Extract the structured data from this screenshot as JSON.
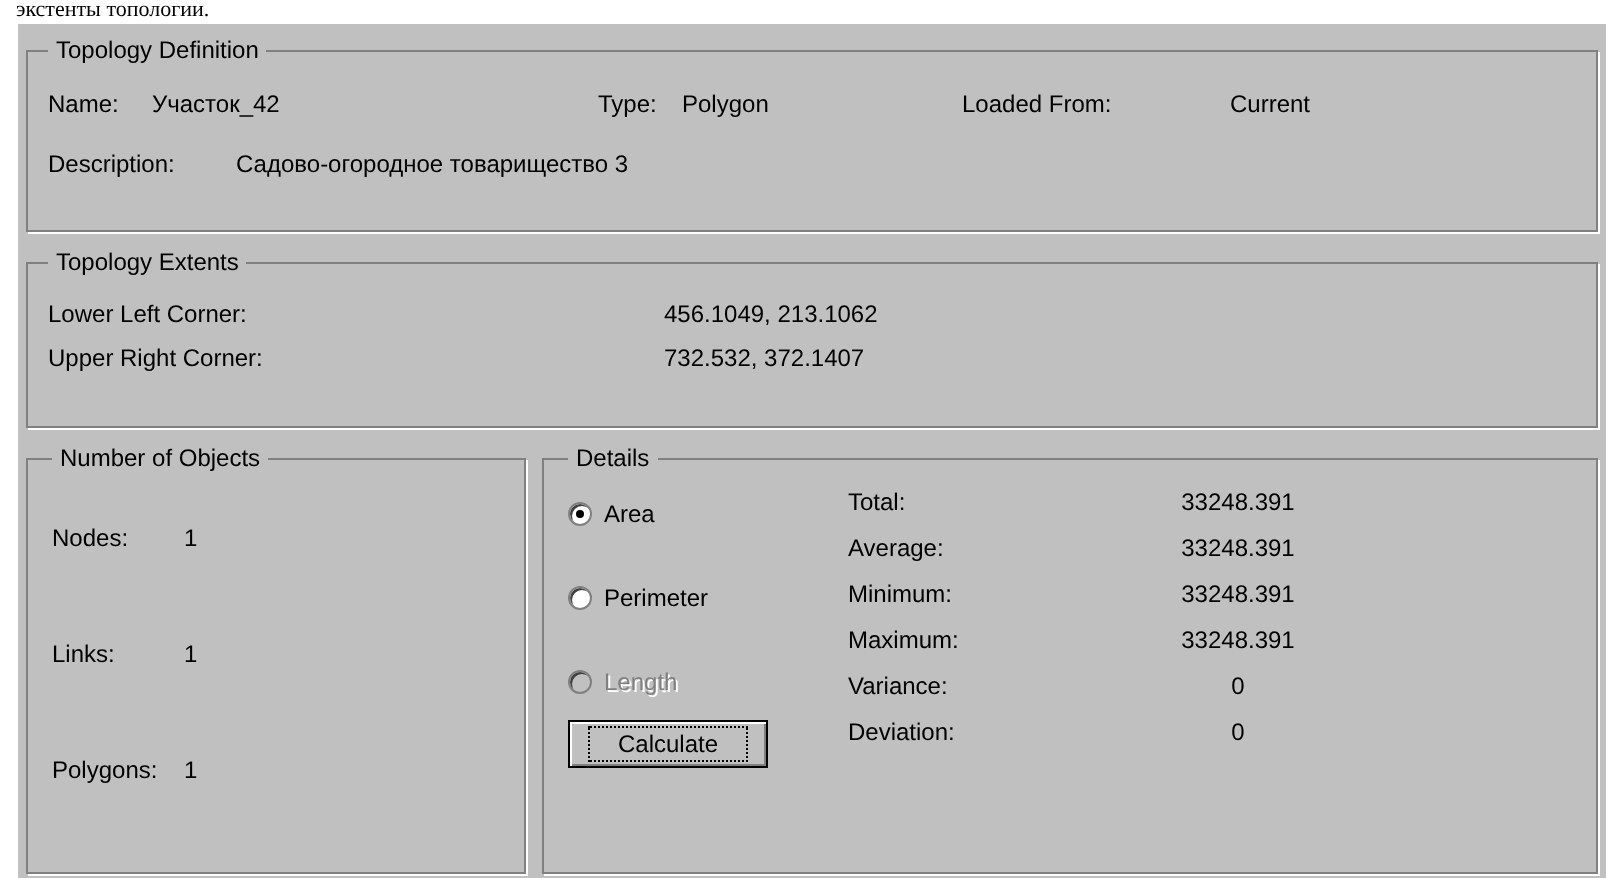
{
  "caption": "экстенты топологии.",
  "topology_definition": {
    "title": "Topology Definition",
    "fields": [
      {
        "label": "Name:",
        "value": "Участок_42"
      },
      {
        "label": "Type:",
        "value": "Polygon"
      },
      {
        "label": "Loaded From:",
        "value": "Current"
      },
      {
        "label": "Description:",
        "value": "Садово-огородное товарищество 3"
      }
    ]
  },
  "topology_extents": {
    "title": "Topology Extents",
    "rows": [
      {
        "label": "Lower Left Corner:",
        "value": "456.1049, 213.1062"
      },
      {
        "label": "Upper Right Corner:",
        "value": "732.532, 372.1407"
      }
    ]
  },
  "number_of_objects": {
    "title": "Number of Objects",
    "rows": [
      {
        "label": "Nodes:",
        "value": "1"
      },
      {
        "label": "Links:",
        "value": "1"
      },
      {
        "label": "Polygons:",
        "value": "1"
      }
    ]
  },
  "details": {
    "title": "Details",
    "options": [
      {
        "label": "Area",
        "selected": true,
        "disabled": false
      },
      {
        "label": "Perimeter",
        "selected": false,
        "disabled": false
      },
      {
        "label": "Length",
        "selected": false,
        "disabled": true
      }
    ],
    "button": "Calculate",
    "stats": [
      {
        "label": "Total:",
        "value": "33248.391"
      },
      {
        "label": "Average:",
        "value": "33248.391"
      },
      {
        "label": "Minimum:",
        "value": "33248.391"
      },
      {
        "label": "Maximum:",
        "value": "33248.391"
      },
      {
        "label": "Variance:",
        "value": "0"
      },
      {
        "label": "Deviation:",
        "value": "0"
      }
    ]
  }
}
